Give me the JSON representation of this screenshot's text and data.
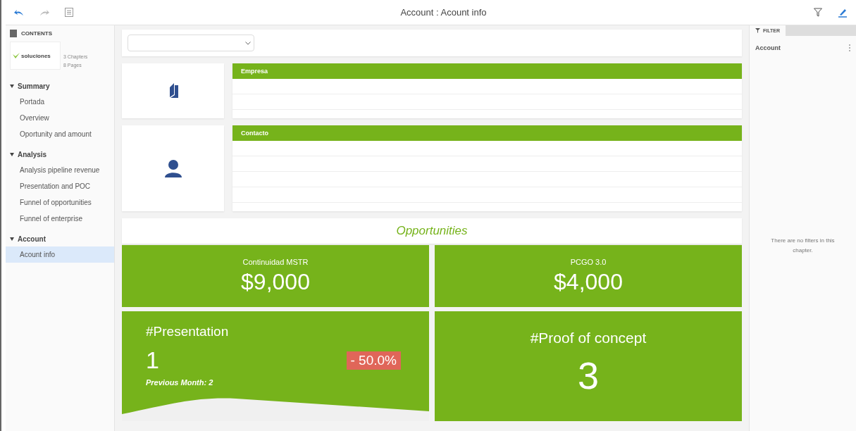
{
  "window": {
    "title": "Account : Acount info"
  },
  "contents": {
    "heading": "CONTENTS",
    "chapters_count": "3 Chapters",
    "pages_count": "8 Pages",
    "logo_text": "soluciones"
  },
  "sections": [
    {
      "title": "Summary",
      "expanded": true,
      "items": [
        {
          "label": "Portada",
          "selected": false
        },
        {
          "label": "Overview",
          "selected": false
        },
        {
          "label": "Oportunity and amount",
          "selected": false
        }
      ]
    },
    {
      "title": "Analysis",
      "expanded": true,
      "items": [
        {
          "label": "Analysis pipeline revenue",
          "selected": false
        },
        {
          "label": "Presentation and POC",
          "selected": false
        },
        {
          "label": "Funnel of opportunities",
          "selected": false
        },
        {
          "label": "Funnel of enterprise",
          "selected": false
        }
      ]
    },
    {
      "title": "Account",
      "expanded": true,
      "items": [
        {
          "label": "Acount info",
          "selected": true
        }
      ]
    }
  ],
  "info_panels": [
    {
      "kind": "company",
      "header": "Empresa"
    },
    {
      "kind": "contact",
      "header": "Contacto"
    }
  ],
  "opportunities": {
    "title": "Opportunities",
    "cards": [
      {
        "label": "Continuidad MSTR",
        "value": "$9,000"
      },
      {
        "label": "PCGO 3.0",
        "value": "$4,000"
      }
    ]
  },
  "presentation": {
    "title": "#Presentation",
    "value": "1",
    "change": "- 50.0%",
    "previous": "Previous Month: 2"
  },
  "proof": {
    "title": "#Proof of concept",
    "value": "3"
  },
  "filter": {
    "tab": "FILTER",
    "chapter": "Account",
    "empty_message": "There are no filters in this chapter."
  }
}
